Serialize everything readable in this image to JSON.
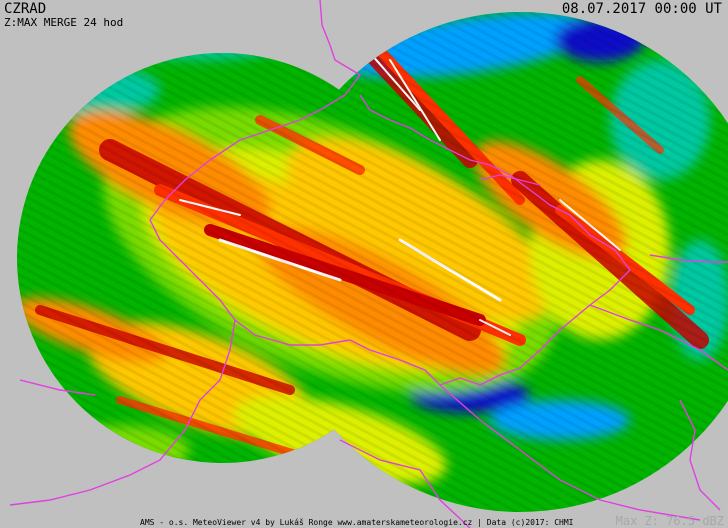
{
  "header": {
    "station": "CZRAD",
    "product": "Z:MAX MERGE 24 hod",
    "timestamp": "08.07.2017 00:00 UT"
  },
  "footer": {
    "credits": "AMS - o.s. MeteoViewer v4 by Lukáš Ronge www.amaterskameteorologie.cz | Data (c)2017: CHMI",
    "max_value": "Max Z: 76.5 dBZ"
  },
  "colors": {
    "background": "#c0c0c0",
    "border_line": "#e040e0",
    "reflectivity_scale": [
      "#1010c8",
      "#00a0ff",
      "#00c8a0",
      "#00b400",
      "#78dc00",
      "#dcf000",
      "#ffc800",
      "#ff8c00",
      "#ff3000",
      "#c80000",
      "#ffffff"
    ]
  }
}
